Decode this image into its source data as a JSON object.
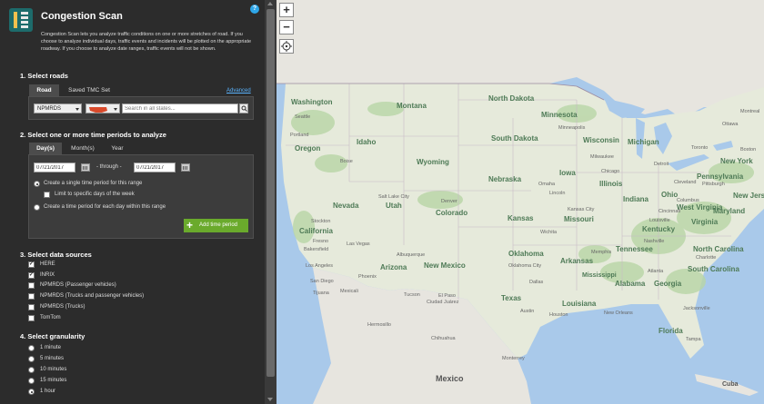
{
  "header": {
    "title": "Congestion Scan",
    "help": "?"
  },
  "description": "Congestion Scan lets you analyze traffic conditions on one or more stretches of road. If you choose to analyze individual days, traffic events and incidents will be plotted on the appropriate roadway. If you choose to analyze date ranges, traffic events will not be shown.",
  "roads": {
    "heading": "1. Select roads",
    "tabs": [
      "Road",
      "Saved TMC Set"
    ],
    "advanced": "Advanced",
    "source_select": "NPMRDS",
    "search_placeholder": "Search in all states..."
  },
  "time": {
    "heading": "2. Select one or more time periods to analyze",
    "tabs": [
      "Day(s)",
      "Month(s)",
      "Year"
    ],
    "start_date": "07/21/2017",
    "through_label": "- through -",
    "end_date": "07/21/2017",
    "options": [
      "Create a single time period for this range",
      "Limit to specific days of the week",
      "Create a time period for each day within this range"
    ],
    "add_button": "Add time period"
  },
  "sources": {
    "heading": "3. Select data sources",
    "items": [
      {
        "label": "HERE",
        "checked": true
      },
      {
        "label": "INRIX",
        "checked": true
      },
      {
        "label": "NPMRDS (Passenger vehicles)",
        "checked": false
      },
      {
        "label": "NPMRDS (Trucks and passenger vehicles)",
        "checked": false
      },
      {
        "label": "NPMRDS (Trucks)",
        "checked": false
      },
      {
        "label": "TomTom",
        "checked": false
      }
    ]
  },
  "granularity": {
    "heading": "4. Select granularity",
    "items": [
      "1 minute",
      "5 minutes",
      "10 minutes",
      "15 minutes",
      "1 hour"
    ],
    "selected": "1 hour"
  },
  "map": {
    "zoom_in": "+",
    "zoom_out": "−",
    "states": [
      "Washington",
      "Oregon",
      "Idaho",
      "Montana",
      "North Dakota",
      "South Dakota",
      "Wyoming",
      "Nebraska",
      "Nevada",
      "Utah",
      "Colorado",
      "Kansas",
      "California",
      "Arizona",
      "New Mexico",
      "Oklahoma",
      "Texas",
      "Minnesota",
      "Wisconsin",
      "Michigan",
      "Iowa",
      "Illinois",
      "Missouri",
      "Indiana",
      "Ohio",
      "Kentucky",
      "Tennessee",
      "Arkansas",
      "Louisiana",
      "Mississippi",
      "Alabama",
      "Georgia",
      "Florida",
      "North Carolina",
      "South Carolina",
      "Virginia",
      "West Virginia",
      "Pennsylvania",
      "New York",
      "Maryland",
      "New Jersey"
    ],
    "cities": [
      "Seattle",
      "Portland",
      "Boise",
      "Salt Lake City",
      "Denver",
      "Stockton",
      "Fresno",
      "Las Vegas",
      "Los Angeles",
      "San Diego",
      "Phoenix",
      "Tucson",
      "Albuquerque",
      "Oklahoma City",
      "Dallas",
      "Austin",
      "Houston",
      "Wichita",
      "Kansas City",
      "Minneapolis",
      "Milwaukee",
      "Chicago",
      "Detroit",
      "Cleveland",
      "Nashville",
      "Memphis",
      "Atlanta",
      "Charlotte",
      "Tampa",
      "Jacksonville",
      "Toronto",
      "Omaha",
      "Lincoln",
      "Bakersfield",
      "El Paso",
      "New Orleans",
      "Louisville",
      "Columbus",
      "Cincinnati",
      "Pittsburgh",
      "Boston",
      "Mexicali",
      "Tijuana",
      "Hermosillo",
      "Ciudad Juárez",
      "Chihuahua",
      "Monterrey",
      "Ottawa",
      "Montreal"
    ],
    "countries": [
      "Mexico",
      "Cuba"
    ]
  }
}
